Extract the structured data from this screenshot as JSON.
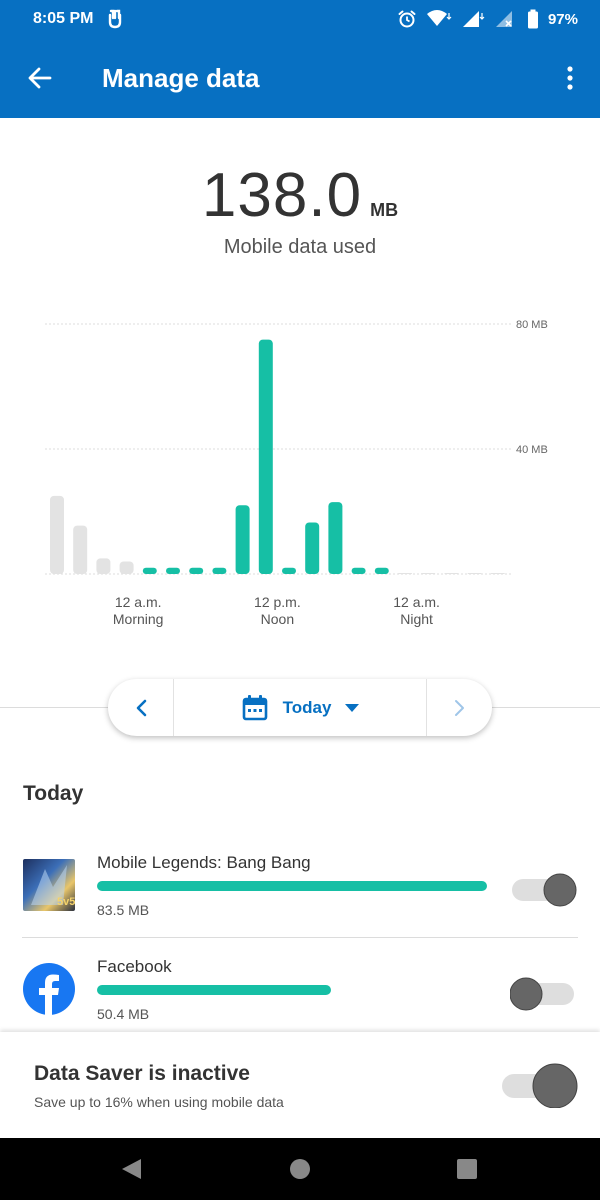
{
  "status_bar": {
    "time": "8:05 PM",
    "battery": "97%"
  },
  "app_bar": {
    "title": "Manage data"
  },
  "summary": {
    "amount": "138.0",
    "unit": "MB",
    "label": "Mobile data used"
  },
  "chart_data": {
    "type": "bar",
    "y_unit": "MB",
    "ylim": [
      0,
      80
    ],
    "y_ticks": [
      "80 MB",
      "40 MB"
    ],
    "x_tick_labels": [
      {
        "line1": "12 a.m.",
        "line2": "Morning",
        "bar_index": 3.5
      },
      {
        "line1": "12 p.m.",
        "line2": "Noon",
        "bar_index": 9.5
      },
      {
        "line1": "12 a.m.",
        "line2": "Night",
        "bar_index": 15.5
      }
    ],
    "values": [
      25,
      15.5,
      5,
      4,
      2,
      2,
      2,
      2,
      22,
      75,
      2,
      16.5,
      23,
      2,
      2,
      0.3,
      0.3,
      0.3,
      0.3,
      0.3
    ],
    "bar_states": [
      "past",
      "past",
      "past",
      "past",
      "active",
      "active",
      "active",
      "active",
      "active",
      "active",
      "active",
      "active",
      "active",
      "active",
      "active",
      "future",
      "future",
      "future",
      "future",
      "future"
    ],
    "colors": {
      "active": "#16bfa5",
      "past": "#e3e3e3",
      "future": "#e3e3e3",
      "grid": "#dddddd"
    }
  },
  "date_selector": {
    "label": "Today"
  },
  "section": {
    "title": "Today"
  },
  "apps": [
    {
      "name": "Mobile Legends: Bang Bang",
      "size": "83.5 MB",
      "usage_fraction": 1.0,
      "enabled": true
    },
    {
      "name": "Facebook",
      "size": "50.4 MB",
      "usage_fraction": 0.6,
      "enabled": false
    }
  ],
  "data_saver": {
    "title": "Data Saver is inactive",
    "subtitle": "Save up to 16% when using mobile data",
    "enabled": true
  },
  "colors": {
    "primary": "#0770c2",
    "accent": "#16bfa5",
    "facebook": "#1877f2"
  }
}
